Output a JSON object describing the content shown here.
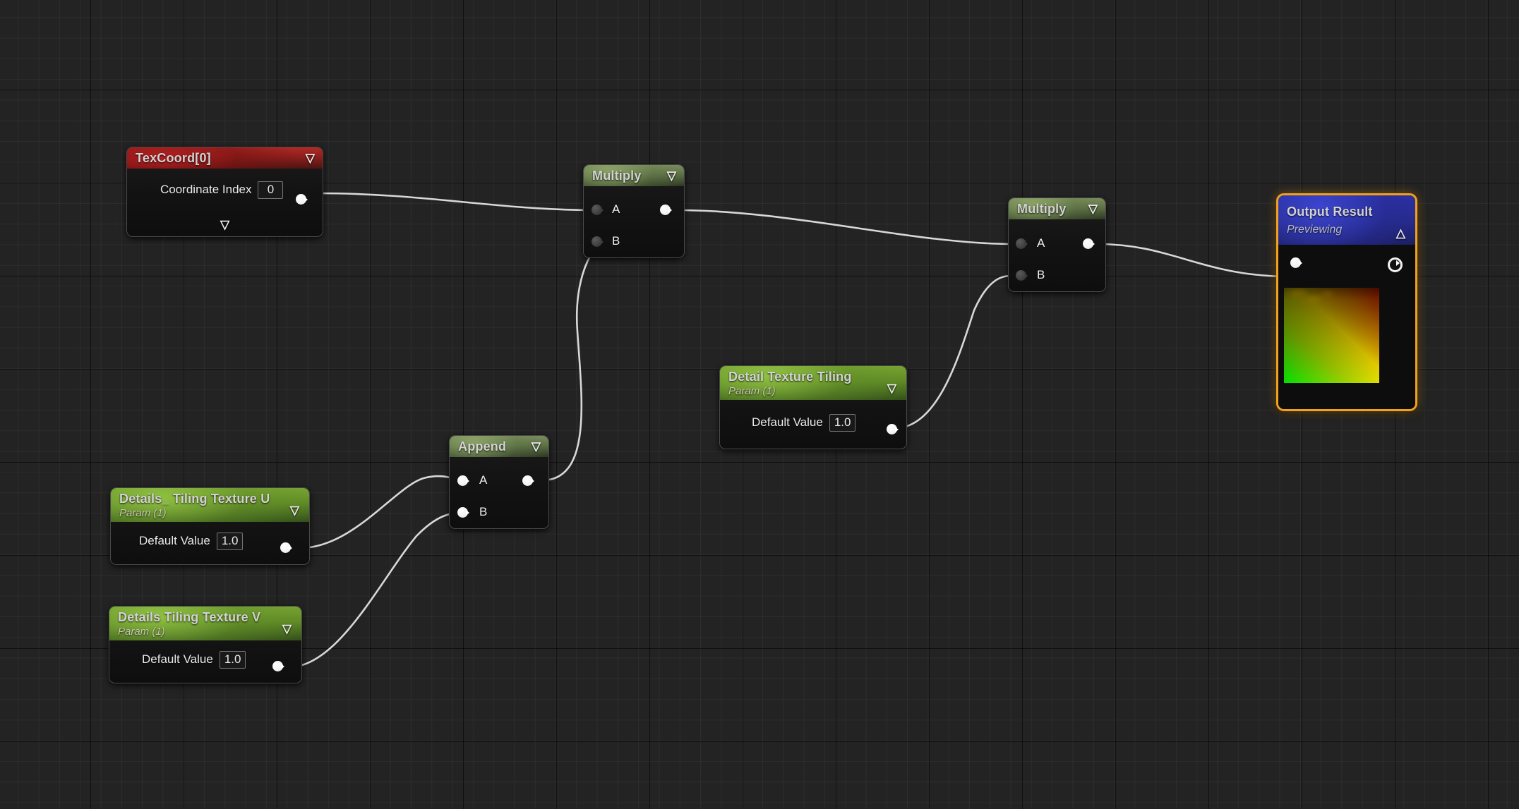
{
  "editor": {
    "name": "unreal-material-graph",
    "background_color": "#232323",
    "grid_line_color": "#2c2c2c",
    "grid_major_color": "#000000",
    "wire_color": "#d8d8d8"
  },
  "nodes": [
    {
      "id": "texcoord",
      "title": "TexCoord[0]",
      "header_color": "#8c1f1c",
      "collapse_icon": "chevron-down-icon",
      "bottom_icon": "chevron-down-icon",
      "rows": [
        {
          "label": "Coordinate Index",
          "value": "0"
        }
      ]
    },
    {
      "id": "multiply-1",
      "title": "Multiply",
      "header_color": "#5e7046",
      "collapse_icon": "chevron-down-icon",
      "inputs": [
        "A",
        "B"
      ],
      "output": ""
    },
    {
      "id": "append",
      "title": "Append",
      "header_color": "#5e7046",
      "collapse_icon": "chevron-down-icon",
      "inputs": [
        "A",
        "B"
      ],
      "output": ""
    },
    {
      "id": "details-tiling-u",
      "title": "Details_ Tiling Texture U",
      "subtitle": "Param (1)",
      "header_color": "#5f8a26",
      "collapse_icon": "chevron-down-icon",
      "rows": [
        {
          "label": "Default Value",
          "value": "1.0"
        }
      ]
    },
    {
      "id": "details-tiling-v",
      "title": "Details Tiling Texture V",
      "subtitle": "Param (1)",
      "header_color": "#5f8a26",
      "collapse_icon": "chevron-down-icon",
      "rows": [
        {
          "label": "Default Value",
          "value": "1.0"
        }
      ]
    },
    {
      "id": "detail-texture-tiling",
      "title": "Detail Texture Tiling",
      "subtitle": "Param (1)",
      "header_color": "#5f8a26",
      "collapse_icon": "chevron-down-icon",
      "rows": [
        {
          "label": "Default Value",
          "value": "1.0"
        }
      ]
    },
    {
      "id": "multiply-2",
      "title": "Multiply",
      "header_color": "#5e7046",
      "collapse_icon": "chevron-down-icon",
      "inputs": [
        "A",
        "B"
      ],
      "output": ""
    },
    {
      "id": "output-result",
      "title": "Output Result",
      "subtitle": "Previewing",
      "header_color": "#272a8a",
      "selection_color": "#f0a11e",
      "collapse_icon": "chevron-up-icon",
      "selected": true
    }
  ]
}
